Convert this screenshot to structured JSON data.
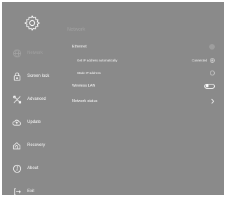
{
  "sidebar": {
    "items": [
      {
        "label": "Network",
        "icon": "globe-icon",
        "active": true
      },
      {
        "label": "Screen lock",
        "icon": "lock-icon"
      },
      {
        "label": "Advanced",
        "icon": "tools-icon"
      },
      {
        "label": "Update",
        "icon": "cloud-upload-icon"
      },
      {
        "label": "Recovery",
        "icon": "recovery-icon"
      },
      {
        "label": "About",
        "icon": "info-icon"
      },
      {
        "label": "Exit",
        "icon": "exit-icon"
      }
    ]
  },
  "content": {
    "title": "Network",
    "ethernet": {
      "label": "Ethernet",
      "auto_label": "Get IP address automatically",
      "auto_status": "Connected",
      "static_label": "Static IP address"
    },
    "wireless": {
      "label": "Wireless LAN",
      "enabled": false
    },
    "network_status": {
      "label": "Network status"
    }
  },
  "colors": {
    "background": "#8a8a8a",
    "text": "#ffffff",
    "muted": "#a3a3a3"
  }
}
